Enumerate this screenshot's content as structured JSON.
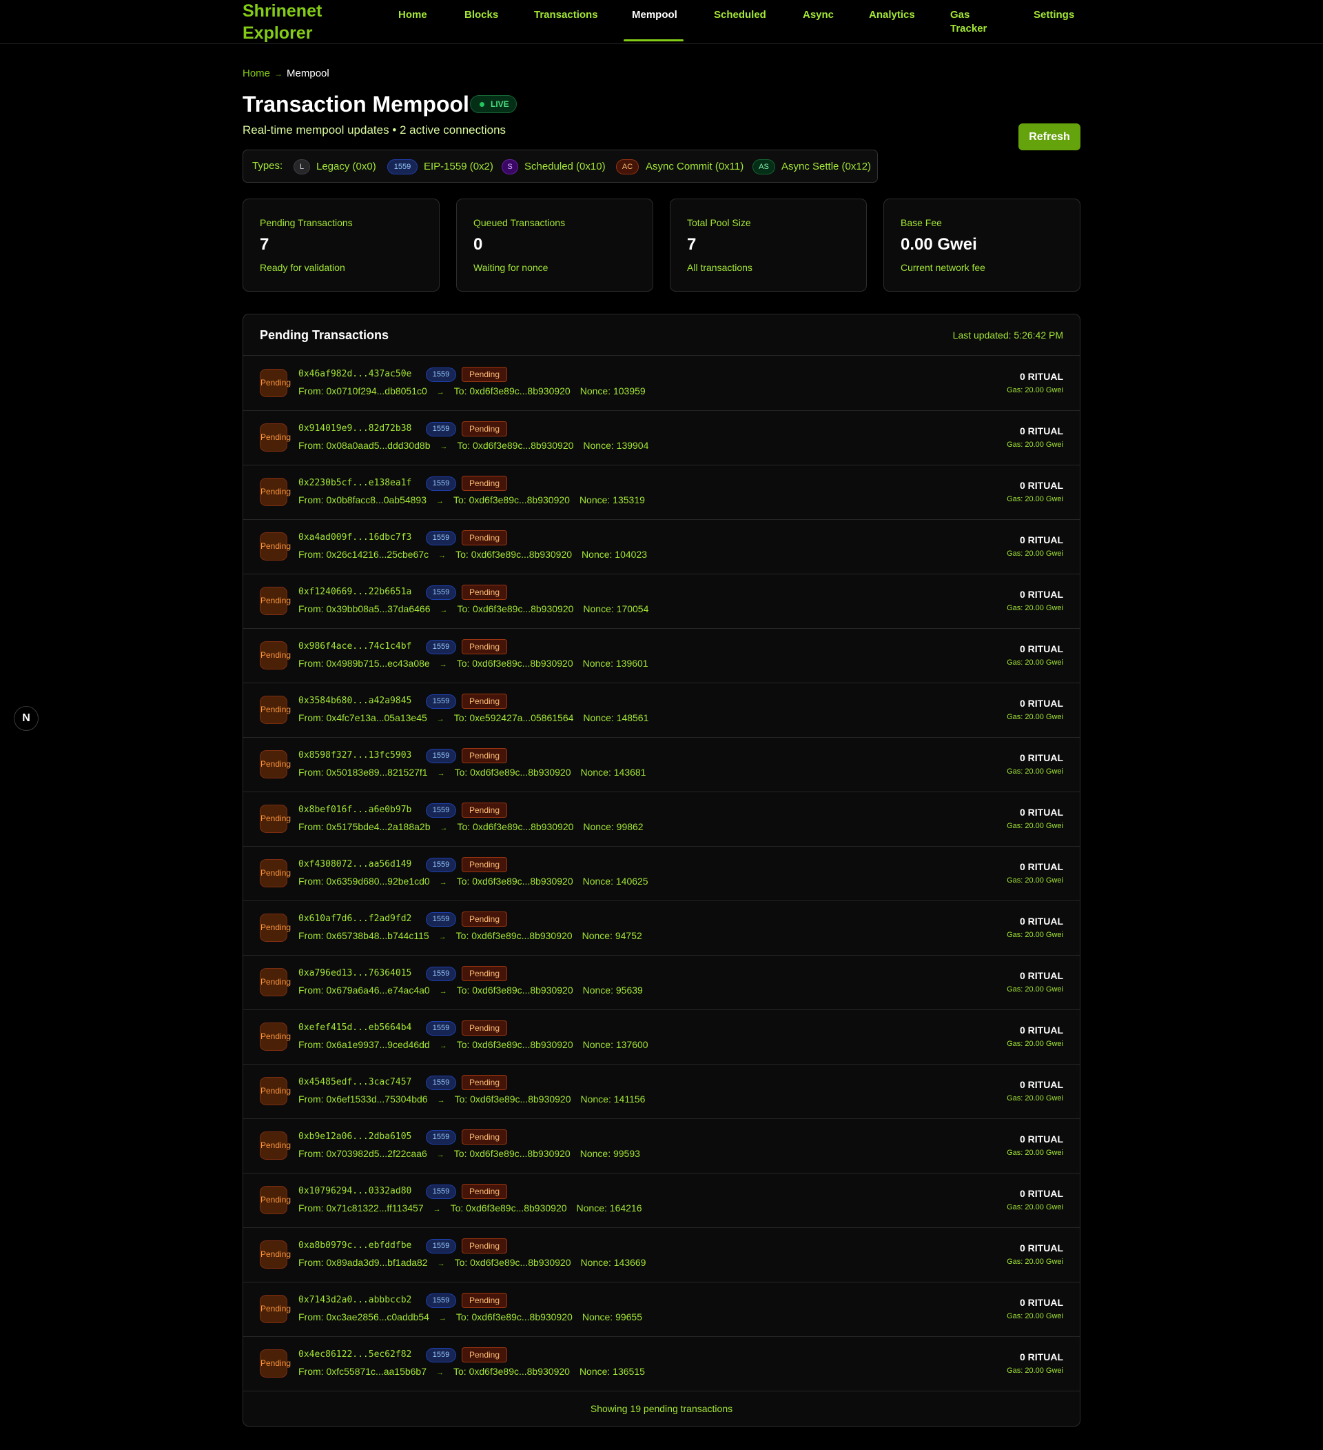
{
  "app": {
    "name": "Shrinenet Explorer"
  },
  "nav": [
    {
      "label": "Home"
    },
    {
      "label": "Blocks"
    },
    {
      "label": "Transactions"
    },
    {
      "label": "Mempool",
      "active": true
    },
    {
      "label": "Scheduled"
    },
    {
      "label": "Async"
    },
    {
      "label": "Analytics"
    },
    {
      "label": "Gas Tracker"
    },
    {
      "label": "Settings"
    }
  ],
  "breadcrumb": {
    "home": "Home",
    "arrow": "→",
    "current": "Mempool"
  },
  "page": {
    "title": "Transaction Mempool",
    "live_label": "LIVE",
    "subtitle": "Real-time mempool updates • 2 active connections",
    "refresh_label": "Refresh"
  },
  "types": {
    "label": "Types:",
    "items": [
      {
        "badge": "L",
        "text": "Legacy (0x0)",
        "color": "#3f3f46"
      },
      {
        "badge": "1559",
        "text": "EIP-1559 (0x2)",
        "color": "#1e40af"
      },
      {
        "badge": "S",
        "text": "Scheduled (0x10)",
        "color": "#6b21a8"
      },
      {
        "badge": "AC",
        "text": "Async Commit (0x11)",
        "color": "#9a3412"
      },
      {
        "badge": "AS",
        "text": "Async Settle (0x12)",
        "color": "#166534"
      }
    ]
  },
  "stats": [
    {
      "label": "Pending Transactions",
      "value": "7",
      "sub": "Ready for validation"
    },
    {
      "label": "Queued Transactions",
      "value": "0",
      "sub": "Waiting for nonce"
    },
    {
      "label": "Total Pool Size",
      "value": "7",
      "sub": "All transactions"
    },
    {
      "label": "Base Fee",
      "value": "0.00 Gwei",
      "sub": "Current network fee"
    }
  ],
  "pending": {
    "title": "Pending Transactions",
    "last_updated": "Last updated: 5:26:42 PM",
    "footer": "Showing 19 pending transactions",
    "rows": [
      {
        "hash": "0x46af982d...437ac50e",
        "from": "From: 0x0710f294...db8051c0",
        "to": "To: 0xd6f3e89c...8b930920",
        "nonce": "Nonce: 103959"
      },
      {
        "hash": "0x914019e9...82d72b38",
        "from": "From: 0x08a0aad5...ddd30d8b",
        "to": "To: 0xd6f3e89c...8b930920",
        "nonce": "Nonce: 139904"
      },
      {
        "hash": "0x2230b5cf...e138ea1f",
        "from": "From: 0x0b8facc8...0ab54893",
        "to": "To: 0xd6f3e89c...8b930920",
        "nonce": "Nonce: 135319"
      },
      {
        "hash": "0xa4ad009f...16dbc7f3",
        "from": "From: 0x26c14216...25cbe67c",
        "to": "To: 0xd6f3e89c...8b930920",
        "nonce": "Nonce: 104023"
      },
      {
        "hash": "0xf1240669...22b6651a",
        "from": "From: 0x39bb08a5...37da6466",
        "to": "To: 0xd6f3e89c...8b930920",
        "nonce": "Nonce: 170054"
      },
      {
        "hash": "0x986f4ace...74c1c4bf",
        "from": "From: 0x4989b715...ec43a08e",
        "to": "To: 0xd6f3e89c...8b930920",
        "nonce": "Nonce: 139601"
      },
      {
        "hash": "0x3584b680...a42a9845",
        "from": "From: 0x4fc7e13a...05a13e45",
        "to": "To: 0xe592427a...05861564",
        "nonce": "Nonce: 148561"
      },
      {
        "hash": "0x8598f327...13fc5903",
        "from": "From: 0x50183e89...821527f1",
        "to": "To: 0xd6f3e89c...8b930920",
        "nonce": "Nonce: 143681"
      },
      {
        "hash": "0x8bef016f...a6e0b97b",
        "from": "From: 0x5175bde4...2a188a2b",
        "to": "To: 0xd6f3e89c...8b930920",
        "nonce": "Nonce: 99862"
      },
      {
        "hash": "0xf4308072...aa56d149",
        "from": "From: 0x6359d680...92be1cd0",
        "to": "To: 0xd6f3e89c...8b930920",
        "nonce": "Nonce: 140625"
      },
      {
        "hash": "0x610af7d6...f2ad9fd2",
        "from": "From: 0x65738b48...b744c115",
        "to": "To: 0xd6f3e89c...8b930920",
        "nonce": "Nonce: 94752"
      },
      {
        "hash": "0xa796ed13...76364015",
        "from": "From: 0x679a6a46...e74ac4a0",
        "to": "To: 0xd6f3e89c...8b930920",
        "nonce": "Nonce: 95639"
      },
      {
        "hash": "0xefef415d...eb5664b4",
        "from": "From: 0x6a1e9937...9ced46dd",
        "to": "To: 0xd6f3e89c...8b930920",
        "nonce": "Nonce: 137600"
      },
      {
        "hash": "0x45485edf...3cac7457",
        "from": "From: 0x6ef1533d...75304bd6",
        "to": "To: 0xd6f3e89c...8b930920",
        "nonce": "Nonce: 141156"
      },
      {
        "hash": "0xb9e12a06...2dba6105",
        "from": "From: 0x703982d5...2f22caa6",
        "to": "To: 0xd6f3e89c...8b930920",
        "nonce": "Nonce: 99593"
      },
      {
        "hash": "0x10796294...0332ad80",
        "from": "From: 0x71c81322...ff113457",
        "to": "To: 0xd6f3e89c...8b930920",
        "nonce": "Nonce: 164216"
      },
      {
        "hash": "0xa8b0979c...ebfddfbe",
        "from": "From: 0x89ada3d9...bf1ada82",
        "to": "To: 0xd6f3e89c...8b930920",
        "nonce": "Nonce: 143669"
      },
      {
        "hash": "0x7143d2a0...abbbccb2",
        "from": "From: 0xc3ae2856...c0addb54",
        "to": "To: 0xd6f3e89c...8b930920",
        "nonce": "Nonce: 99655"
      },
      {
        "hash": "0x4ec86122...5ec62f82",
        "from": "From: 0xfc55871c...aa15b6b7",
        "to": "To: 0xd6f3e89c...8b930920",
        "nonce": "Nonce: 136515"
      }
    ],
    "row_common": {
      "icon_label": "Pending",
      "type_badge": "1559",
      "status": "Pending",
      "arrow": "→",
      "amount": "0 RITUAL",
      "gas": "Gas: 20.00 Gwei"
    }
  },
  "dev_badge": {
    "label": "N"
  }
}
